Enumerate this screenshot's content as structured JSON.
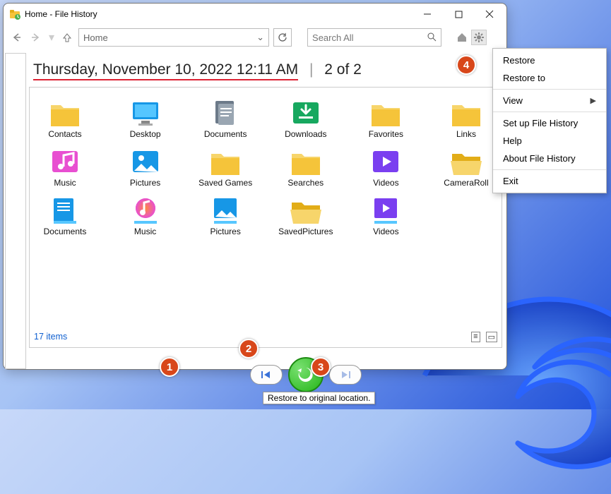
{
  "window": {
    "title": "Home - File History"
  },
  "nav": {
    "path": "Home",
    "search_placeholder": "Search All"
  },
  "header": {
    "date_string": "Thursday, November 10, 2022 12:11 AM",
    "position": "2 of 2"
  },
  "grid": {
    "items": [
      {
        "label": "Contacts",
        "icon": "folder-yellow"
      },
      {
        "label": "Desktop",
        "icon": "desktop"
      },
      {
        "label": "Documents",
        "icon": "documents"
      },
      {
        "label": "Downloads",
        "icon": "downloads"
      },
      {
        "label": "Favorites",
        "icon": "folder-yellow"
      },
      {
        "label": "Links",
        "icon": "folder-yellow"
      },
      {
        "label": "Music",
        "icon": "music"
      },
      {
        "label": "Pictures",
        "icon": "pictures"
      },
      {
        "label": "Saved Games",
        "icon": "folder-yellow"
      },
      {
        "label": "Searches",
        "icon": "folder-yellow"
      },
      {
        "label": "Videos",
        "icon": "videos"
      },
      {
        "label": "CameraRoll",
        "icon": "folder-open"
      },
      {
        "label": "Documents",
        "icon": "doc-lib"
      },
      {
        "label": "Music",
        "icon": "music-lib"
      },
      {
        "label": "Pictures",
        "icon": "pic-lib"
      },
      {
        "label": "SavedPictures",
        "icon": "folder-open"
      },
      {
        "label": "Videos",
        "icon": "video-lib"
      }
    ]
  },
  "status": {
    "count_text": "17 items"
  },
  "tooltip": "Restore to original location.",
  "context_menu": {
    "items": [
      {
        "label": "Restore",
        "type": "item"
      },
      {
        "label": "Restore to",
        "type": "item"
      },
      {
        "sep": true
      },
      {
        "label": "View",
        "type": "submenu"
      },
      {
        "sep": true
      },
      {
        "label": "Set up File History",
        "type": "item"
      },
      {
        "label": "Help",
        "type": "item"
      },
      {
        "label": "About File History",
        "type": "item"
      },
      {
        "sep": true
      },
      {
        "label": "Exit",
        "type": "item"
      }
    ]
  },
  "annotations": {
    "a1": "1",
    "a2": "2",
    "a3": "3",
    "a4": "4"
  }
}
